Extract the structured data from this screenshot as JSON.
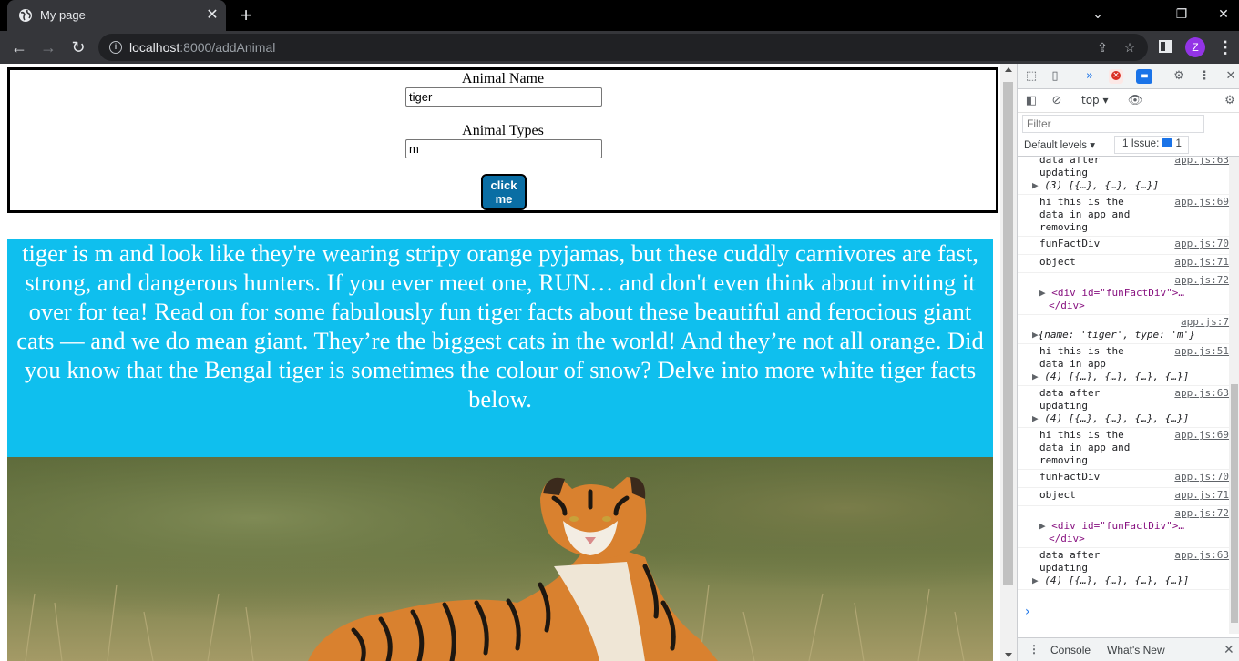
{
  "browser": {
    "tab_title": "My page",
    "url_host": "localhost",
    "url_rest": ":8000/addAnimal",
    "profile_initial": "Z"
  },
  "form": {
    "name_label": "Animal Name",
    "name_value": "tiger",
    "types_label": "Animal Types",
    "types_value": "m",
    "button_label": "click me"
  },
  "fun_fact": {
    "text": "tiger is m and look like they're wearing stripy orange pyjamas, but these cuddly carnivores are fast, strong, and dangerous hunters. If you ever meet one, RUN… and don't even think about inviting it over for tea! Read on for some fabulously fun tiger facts about these beautiful and ferocious giant cats — and we do mean giant. They’re the biggest cats in the world! And they’re not all orange. Did you know that the Bengal tiger is sometimes the colour of snow? Delve into more white tiger facts below."
  },
  "devtools": {
    "context": "top",
    "filter_placeholder": "Filter",
    "levels": "Default levels",
    "issues_label": "1 Issue:",
    "issues_count": "1",
    "logs": [
      {
        "text": "data after\nupdating",
        "src": "app.js:63",
        "extra": "(3) [{…}, {…}, {…}]"
      },
      {
        "text": "hi this is the\ndata in app and removing",
        "src": "app.js:69"
      },
      {
        "text": "funFactDiv",
        "src": "app.js:70"
      },
      {
        "text": "object",
        "src": "app.js:71"
      },
      {
        "text": "",
        "src": "app.js:72",
        "element": true
      },
      {
        "text": "",
        "src": "app.js:7",
        "object": true
      },
      {
        "text": "hi this is the\ndata in app",
        "src": "app.js:51",
        "extra": "(4) [{…}, {…}, {…}, {…}]"
      },
      {
        "text": "data after\nupdating",
        "src": "app.js:63",
        "extra": "(4) [{…}, {…}, {…}, {…}]"
      },
      {
        "text": "hi this is the\ndata in app and removing",
        "src": "app.js:69"
      },
      {
        "text": "funFactDiv",
        "src": "app.js:70"
      },
      {
        "text": "object",
        "src": "app.js:71"
      },
      {
        "text": "",
        "src": "app.js:72",
        "element": true
      },
      {
        "text": "data after\nupdating",
        "src": "app.js:63",
        "extra": "(4) [{…}, {…}, {…}, {…}]"
      }
    ],
    "element_open": "<div id=\"funFactDiv\">…",
    "element_close": "</div>",
    "object_preview": "{name: 'tiger', type: 'm'}",
    "drawer_tabs": [
      "Console",
      "What's New"
    ]
  },
  "colors": {
    "fun_fact_bg": "#0fbfee",
    "button_bg": "#0a6ea4"
  }
}
